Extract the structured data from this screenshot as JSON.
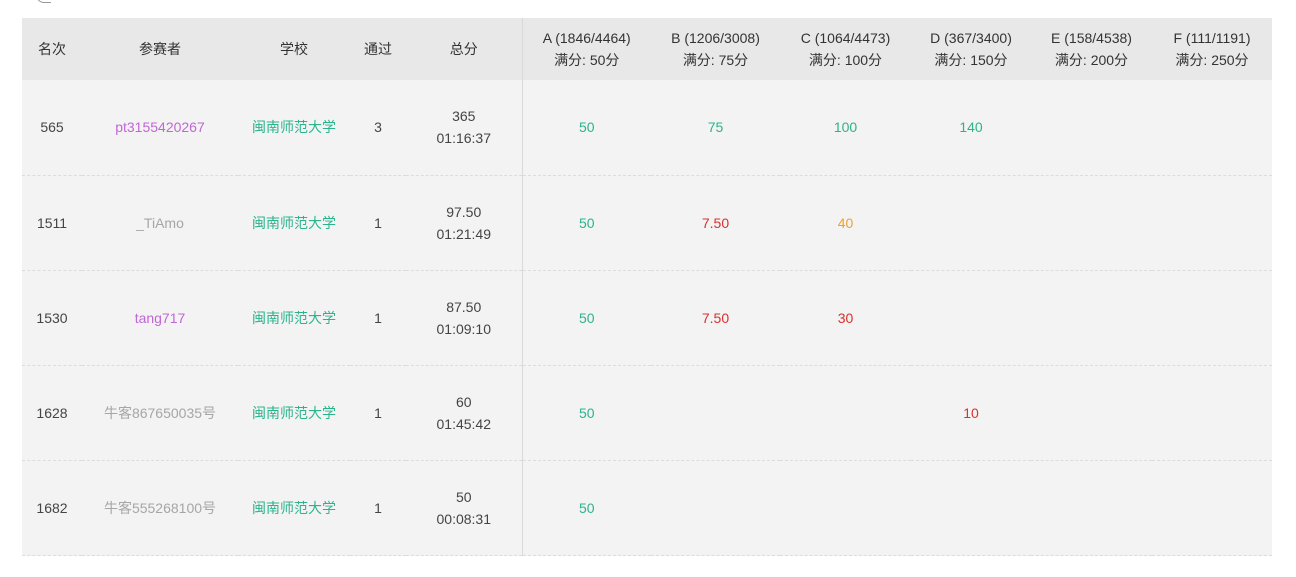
{
  "header": {
    "rank": "名次",
    "participant": "参赛者",
    "school": "学校",
    "passed": "通过",
    "total": "总分",
    "problems": [
      {
        "title": "A (1846/4464)",
        "full": "满分: 50分"
      },
      {
        "title": "B (1206/3008)",
        "full": "满分: 75分"
      },
      {
        "title": "C (1064/4473)",
        "full": "满分: 100分"
      },
      {
        "title": "D (367/3400)",
        "full": "满分: 150分"
      },
      {
        "title": "E (158/4538)",
        "full": "满分: 200分"
      },
      {
        "title": "F (111/1191)",
        "full": "满分: 250分"
      }
    ]
  },
  "rows": [
    {
      "rank": "565",
      "user": "pt3155420267",
      "school": "闽南师范大学",
      "passed": "3",
      "score": "365",
      "time": "01:16:37",
      "cells": [
        "50",
        "75",
        "100",
        "140",
        "",
        ""
      ]
    },
    {
      "rank": "1511",
      "user": "_TiAmo",
      "school": "闽南师范大学",
      "passed": "1",
      "score": "97.50",
      "time": "01:21:49",
      "cells": [
        "50",
        "7.50",
        "40",
        "",
        "",
        ""
      ]
    },
    {
      "rank": "1530",
      "user": "tang717",
      "school": "闽南师范大学",
      "passed": "1",
      "score": "87.50",
      "time": "01:09:10",
      "cells": [
        "50",
        "7.50",
        "30",
        "",
        "",
        ""
      ]
    },
    {
      "rank": "1628",
      "user": "牛客867650035号",
      "school": "闽南师范大学",
      "passed": "1",
      "score": "60",
      "time": "01:45:42",
      "cells": [
        "50",
        "",
        "",
        "10",
        "",
        ""
      ]
    },
    {
      "rank": "1682",
      "user": "牛客555268100号",
      "school": "闽南师范大学",
      "passed": "1",
      "score": "50",
      "time": "00:08:31",
      "cells": [
        "50",
        "",
        "",
        "",
        "",
        ""
      ]
    }
  ],
  "colors": {
    "green": "#2bb48c",
    "red": "#d9312e",
    "orange": "#f0a12c",
    "purple": "#c066d6",
    "gray": "#a6a6a6"
  }
}
